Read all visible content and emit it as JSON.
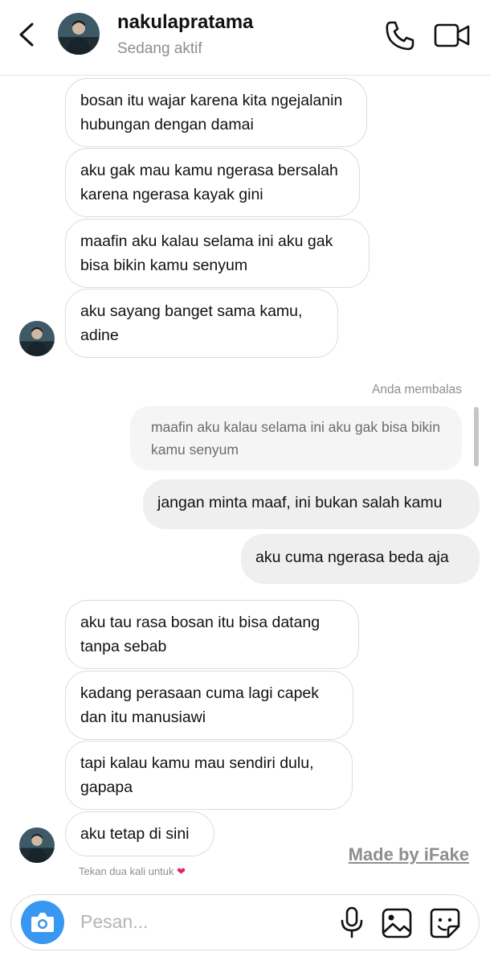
{
  "header": {
    "username": "nakulapratama",
    "status": "Sedang aktif"
  },
  "messages_top": [
    {
      "text": "bosan itu wajar karena kita ngejalanin hubungan dengan damai"
    },
    {
      "text": "aku gak mau kamu ngerasa bersalah karena ngerasa kayak gini"
    },
    {
      "text": "maafin aku kalau selama ini aku gak bisa bikin kamu senyum"
    },
    {
      "text": "aku sayang banget sama kamu, adine"
    }
  ],
  "reply": {
    "label": "Anda membalas",
    "quoted": "maafin aku kalau selama ini aku gak bisa bikin kamu senyum"
  },
  "sent_messages": [
    {
      "text": "jangan minta maaf, ini bukan salah kamu"
    },
    {
      "text": "aku cuma ngerasa beda aja"
    }
  ],
  "messages_bottom": [
    {
      "text": "aku tau rasa bosan itu bisa datang tanpa sebab"
    },
    {
      "text": "kadang perasaan cuma lagi capek dan itu manusiawi"
    },
    {
      "text": "tapi kalau kamu mau sendiri dulu, gapapa"
    },
    {
      "text": "aku tetap di sini"
    }
  ],
  "hint": "Tekan dua kali untuk",
  "watermark": "Made by iFake",
  "composer": {
    "placeholder": "Pesan..."
  },
  "icons": {
    "back": "chevron-left-icon",
    "phone": "phone-icon",
    "video": "video-call-icon",
    "camera": "camera-icon",
    "mic": "microphone-icon",
    "gallery": "gallery-icon",
    "sticker": "sticker-icon",
    "heart": "heart-icon"
  },
  "colors": {
    "accent": "#3897f0",
    "heart": "#e0245e",
    "sent_bubble": "#efefef",
    "secondary_text": "#8e8e8e"
  }
}
